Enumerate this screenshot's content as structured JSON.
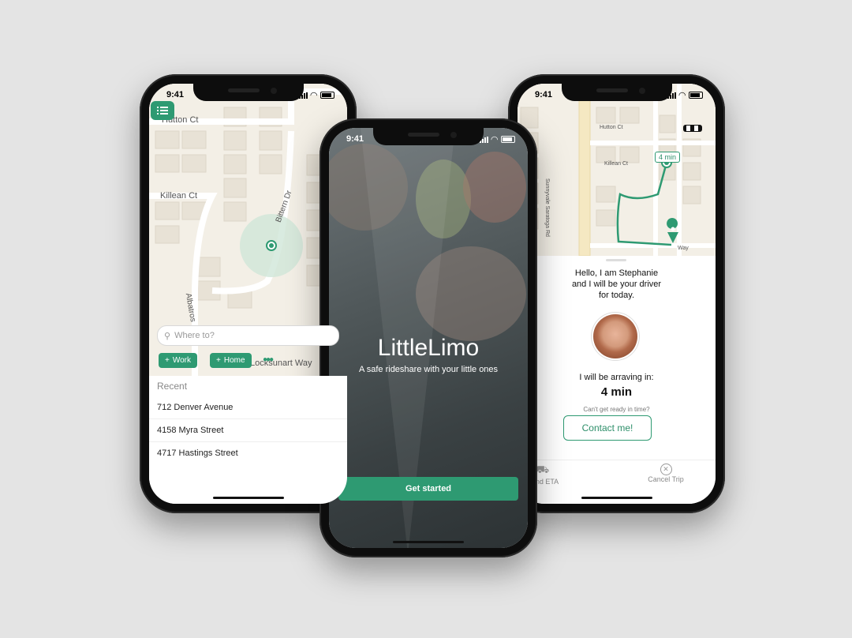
{
  "status_time": "9:41",
  "left": {
    "streets": [
      "Hutton Ct",
      "Killean Ct",
      "Bittern Dr",
      "Albatros",
      "Locksunart Way"
    ],
    "search_placeholder": "Where to?",
    "chips": [
      "Work",
      "Home"
    ],
    "recent_header": "Recent",
    "recent": [
      "712  Denver Avenue",
      "4158  Myra Street",
      "4717  Hastings Street"
    ]
  },
  "center": {
    "title": "LittleLimo",
    "subtitle": "A safe rideshare with your little ones",
    "cta": "Get started"
  },
  "right": {
    "streets": [
      "Sunnyvale Saratoga Rd",
      "Hutton Ct",
      "Killean Ct",
      "Way"
    ],
    "eta_badge": "4 min",
    "greeting_1": "Hello, I am Stephanie",
    "greeting_2": "and I will be your driver",
    "greeting_3": "for today.",
    "arriving_label": "I will be arraving in:",
    "arriving_value": "4 min",
    "cant_ready": "Can't get ready in time?",
    "contact": "Contact me!",
    "tab_send": "Send ETA",
    "tab_cancel": "Cancel Trip"
  },
  "colors": {
    "accent": "#2e9a72",
    "map_bg": "#f3efe6"
  }
}
